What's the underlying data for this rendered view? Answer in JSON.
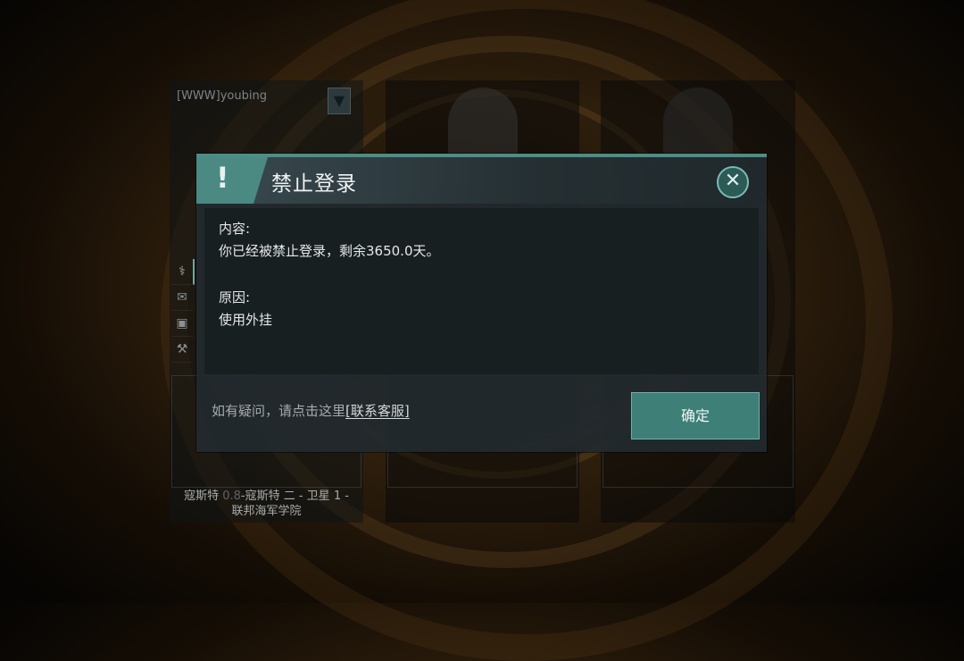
{
  "slots": [
    {
      "player_name": "[WWW]youbing",
      "location_pre": "寇斯特 ",
      "location_sec": "0.8",
      "location_post": "-寇斯特 二 - 卫星 1 -",
      "location_line2": "联邦海军学院"
    },
    {},
    {}
  ],
  "side_icons": [
    "dna-icon",
    "mail-icon",
    "wallet-icon",
    "tool-icon"
  ],
  "dialog": {
    "title": "禁止登录",
    "warn_symbol": "!",
    "close_symbol": "✕",
    "content_label": "内容:",
    "content_body": "你已经被禁止登录，剩余3650.0天。",
    "reason_label": "原因:",
    "reason_body": "使用外挂",
    "help_text": "如有疑问，请点击这里",
    "help_link": "[联系客服]",
    "confirm_label": "确定"
  },
  "colors": {
    "accent": "#4d8d86",
    "confirm_bg": "#3e7f78"
  }
}
